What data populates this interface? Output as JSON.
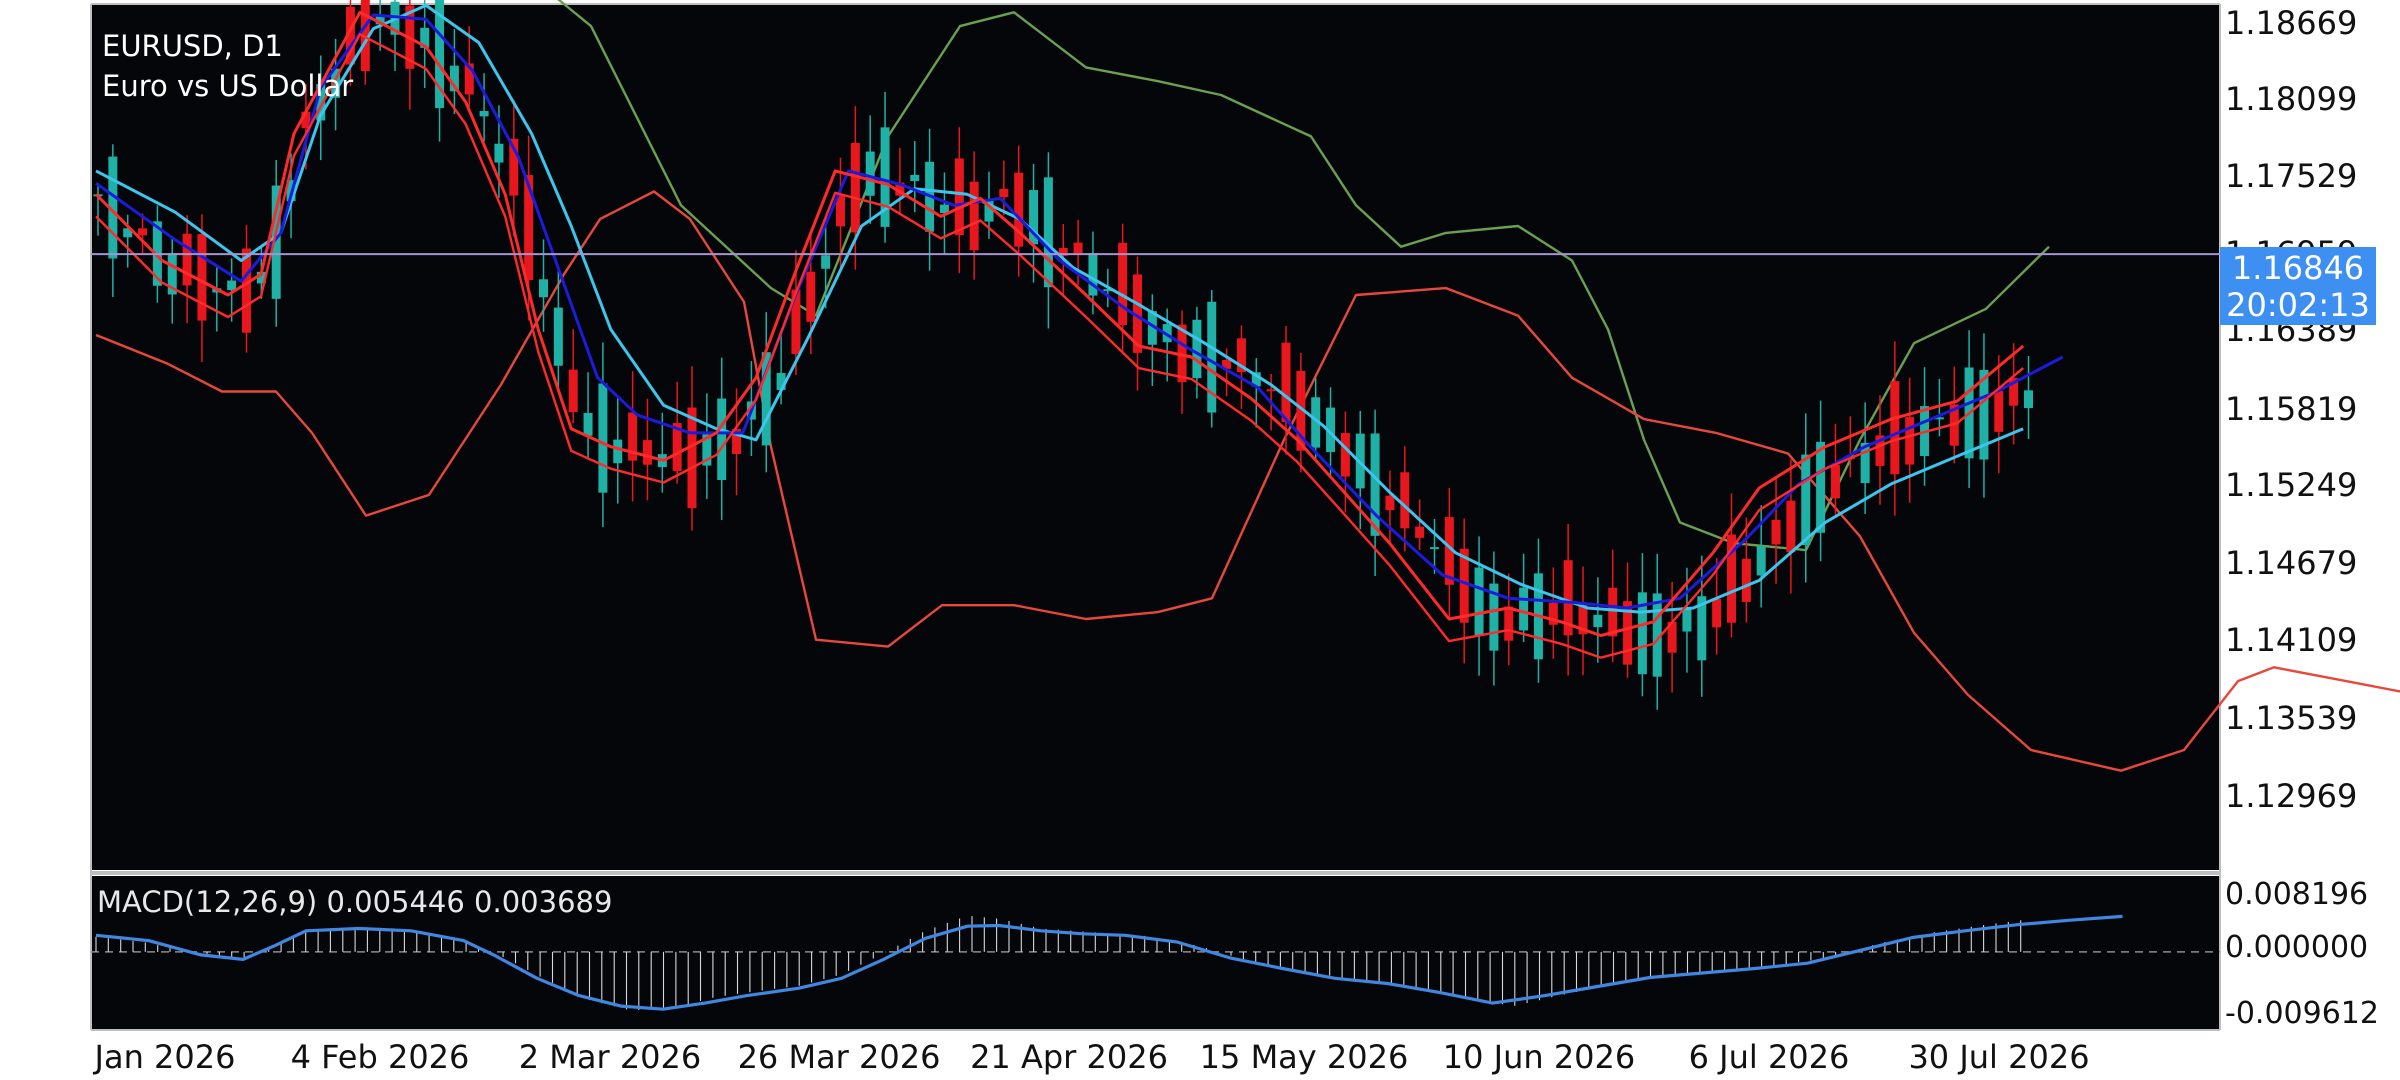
{
  "header": {
    "symbol_line": "EURUSD, D1",
    "description": "Euro vs US Dollar"
  },
  "price_box": {
    "price": "1.16846",
    "countdown": "20:02:13"
  },
  "macd_label": "MACD(12,26,9) 0.005446 0.003689",
  "more_label": "•••",
  "colors": {
    "background": "#ffffff",
    "plot_bg": "#050609",
    "bull": "#1fb0a6",
    "bear": "#e8171d",
    "ma_fast": "#ff2a2a",
    "ma_mid": "#1c1cdc",
    "ma_slow": "#3cc6ee",
    "band_upper": "#6aa052",
    "band_lower": "#e8483c",
    "price_line": "#a594d0",
    "macd_line": "#3f87e0",
    "hist": "#d8d8d8",
    "price_tag": "#3e8ff2"
  },
  "chart_data": [
    {
      "type": "candlestick",
      "title": "EURUSD, D1",
      "subtitle": "Euro vs US Dollar",
      "y_ticks": [
        "1.18669",
        "1.18099",
        "1.17529",
        "1.16959",
        "1.16389",
        "1.15819",
        "1.15249",
        "1.14679",
        "1.14109",
        "1.13539",
        "1.12969"
      ],
      "ylim": [
        1.1238,
        1.1866
      ],
      "x_ticks": [
        "Jan 2026",
        "4 Feb 2026",
        "2 Mar 2026",
        "26 Mar 2026",
        "21 Apr 2026",
        "15 May 2026",
        "10 Jun 2026",
        "6 Jul 2026",
        "30 Jul 2026"
      ],
      "x_tick_index": [
        0,
        26,
        50,
        74,
        100,
        124,
        150,
        174,
        198
      ],
      "current_price": 1.16846,
      "bands": {
        "upper": [
          [
            0,
            1.193
          ],
          [
            20,
            1.19
          ],
          [
            40,
            1.193
          ],
          [
            55,
            1.185
          ],
          [
            65,
            1.172
          ],
          [
            75,
            1.166
          ],
          [
            80,
            1.164
          ],
          [
            88,
            1.177
          ],
          [
            96,
            1.185
          ],
          [
            102,
            1.186
          ],
          [
            110,
            1.182
          ],
          [
            118,
            1.181
          ],
          [
            125,
            1.18
          ],
          [
            135,
            1.177
          ],
          [
            140,
            1.172
          ],
          [
            145,
            1.169
          ],
          [
            150,
            1.17
          ],
          [
            158,
            1.1705
          ],
          [
            164,
            1.168
          ],
          [
            168,
            1.163
          ],
          [
            172,
            1.155
          ],
          [
            176,
            1.149
          ],
          [
            182,
            1.1475
          ],
          [
            190,
            1.147
          ],
          [
            196,
            1.155
          ],
          [
            202,
            1.162
          ],
          [
            210,
            1.1645
          ],
          [
            217,
            1.169
          ]
        ],
        "lower": [
          [
            0,
            1.1626
          ],
          [
            8,
            1.1605
          ],
          [
            14,
            1.1585
          ],
          [
            20,
            1.1585
          ],
          [
            24,
            1.1555
          ],
          [
            30,
            1.1495
          ],
          [
            37,
            1.151
          ],
          [
            45,
            1.159
          ],
          [
            52,
            1.167
          ],
          [
            56,
            1.171
          ],
          [
            62,
            1.173
          ],
          [
            66,
            1.171
          ],
          [
            72,
            1.165
          ],
          [
            75,
            1.1545
          ],
          [
            80,
            1.1405
          ],
          [
            88,
            1.14
          ],
          [
            94,
            1.143
          ],
          [
            102,
            1.143
          ],
          [
            110,
            1.142
          ],
          [
            118,
            1.1425
          ],
          [
            124,
            1.1435
          ],
          [
            132,
            1.155
          ],
          [
            140,
            1.1655
          ],
          [
            150,
            1.166
          ],
          [
            158,
            1.164
          ],
          [
            164,
            1.1595
          ],
          [
            172,
            1.1565
          ],
          [
            180,
            1.1555
          ],
          [
            188,
            1.154
          ],
          [
            196,
            1.148
          ],
          [
            202,
            1.141
          ],
          [
            208,
            1.1365
          ],
          [
            215,
            1.1325
          ],
          [
            225,
            1.131
          ],
          [
            232,
            1.1325
          ],
          [
            238,
            1.1375
          ],
          [
            242,
            1.1385
          ],
          [
            250,
            1.1375
          ],
          [
            258,
            1.1365
          ],
          [
            265,
            1.1355
          ],
          [
            272,
            1.134
          ],
          [
            280,
            1.1345
          ],
          [
            288,
            1.1355
          ],
          [
            295,
            1.1375
          ],
          [
            302,
            1.1425
          ]
        ]
      },
      "moving_averages": {
        "fast": [
          [
            0,
            1.1728
          ],
          [
            10,
            1.168
          ],
          [
            20,
            1.1655
          ],
          [
            25,
            1.167
          ],
          [
            30,
            1.1772
          ],
          [
            40,
            1.186
          ],
          [
            50,
            1.1835
          ],
          [
            56,
            1.1795
          ],
          [
            62,
            1.1728
          ],
          [
            67,
            1.163
          ],
          [
            72,
            1.1558
          ],
          [
            78,
            1.1545
          ],
          [
            86,
            1.1535
          ],
          [
            94,
            1.1555
          ],
          [
            100,
            1.1595
          ],
          [
            106,
            1.1672
          ],
          [
            112,
            1.1745
          ],
          [
            120,
            1.1735
          ],
          [
            128,
            1.1712
          ],
          [
            134,
            1.1725
          ],
          [
            140,
            1.17
          ],
          [
            150,
            1.1655
          ],
          [
            158,
            1.1618
          ],
          [
            166,
            1.161
          ],
          [
            175,
            1.158
          ],
          [
            182,
            1.155
          ],
          [
            188,
            1.1518
          ],
          [
            196,
            1.1475
          ],
          [
            205,
            1.142
          ],
          [
            214,
            1.1428
          ],
          [
            222,
            1.1418
          ],
          [
            228,
            1.1408
          ],
          [
            236,
            1.1418
          ],
          [
            245,
            1.1468
          ],
          [
            252,
            1.1515
          ],
          [
            262,
            1.1545
          ],
          [
            272,
            1.1565
          ],
          [
            282,
            1.1578
          ],
          [
            292,
            1.1618
          ]
        ],
        "mid": [
          [
            0,
            1.1736
          ],
          [
            12,
            1.1695
          ],
          [
            22,
            1.1665
          ],
          [
            28,
            1.17
          ],
          [
            34,
            1.1805
          ],
          [
            42,
            1.1858
          ],
          [
            50,
            1.1855
          ],
          [
            57,
            1.1818
          ],
          [
            64,
            1.1755
          ],
          [
            70,
            1.1675
          ],
          [
            76,
            1.1595
          ],
          [
            82,
            1.1568
          ],
          [
            90,
            1.1555
          ],
          [
            98,
            1.1555
          ],
          [
            106,
            1.1655
          ],
          [
            114,
            1.1745
          ],
          [
            122,
            1.1735
          ],
          [
            130,
            1.172
          ],
          [
            137,
            1.1725
          ],
          [
            146,
            1.168
          ],
          [
            156,
            1.1645
          ],
          [
            166,
            1.1615
          ],
          [
            176,
            1.1588
          ],
          [
            184,
            1.1545
          ],
          [
            194,
            1.1495
          ],
          [
            204,
            1.1452
          ],
          [
            214,
            1.1435
          ],
          [
            224,
            1.1432
          ],
          [
            232,
            1.1428
          ],
          [
            240,
            1.1435
          ],
          [
            250,
            1.1478
          ],
          [
            258,
            1.1518
          ],
          [
            268,
            1.1545
          ],
          [
            278,
            1.1565
          ],
          [
            288,
            1.1585
          ],
          [
            298,
            1.161
          ]
        ],
        "slow": [
          [
            0,
            1.1745
          ],
          [
            12,
            1.1715
          ],
          [
            22,
            1.168
          ],
          [
            28,
            1.17
          ],
          [
            34,
            1.1785
          ],
          [
            42,
            1.1848
          ],
          [
            50,
            1.1865
          ],
          [
            58,
            1.1838
          ],
          [
            66,
            1.1772
          ],
          [
            72,
            1.1705
          ],
          [
            78,
            1.163
          ],
          [
            86,
            1.1575
          ],
          [
            94,
            1.1558
          ],
          [
            100,
            1.155
          ],
          [
            108,
            1.1625
          ],
          [
            116,
            1.1705
          ],
          [
            124,
            1.1732
          ],
          [
            132,
            1.1728
          ],
          [
            140,
            1.171
          ],
          [
            148,
            1.1675
          ],
          [
            158,
            1.1648
          ],
          [
            168,
            1.162
          ],
          [
            178,
            1.159
          ],
          [
            186,
            1.156
          ],
          [
            196,
            1.1512
          ],
          [
            206,
            1.1468
          ],
          [
            216,
            1.1445
          ],
          [
            226,
            1.1428
          ],
          [
            234,
            1.1425
          ],
          [
            242,
            1.1428
          ],
          [
            252,
            1.1448
          ],
          [
            262,
            1.149
          ],
          [
            272,
            1.1518
          ],
          [
            282,
            1.1538
          ],
          [
            292,
            1.1558
          ]
        ]
      }
    },
    {
      "type": "macd",
      "title": "MACD(12,26,9) 0.005446 0.003689",
      "y_ticks": [
        "0.008196",
        "0.000000",
        "-0.009612"
      ],
      "ylim": [
        -0.0101,
        0.0098
      ],
      "macd": 0.005446,
      "signal": 0.003689,
      "signal_line": [
        [
          0,
          0.0022
        ],
        [
          10,
          0.0015
        ],
        [
          20,
          -0.0004
        ],
        [
          28,
          -0.001
        ],
        [
          34,
          0.0008
        ],
        [
          40,
          0.0028
        ],
        [
          50,
          0.0031
        ],
        [
          60,
          0.0028
        ],
        [
          70,
          0.0015
        ],
        [
          76,
          -0.0005
        ],
        [
          84,
          -0.0035
        ],
        [
          92,
          -0.0058
        ],
        [
          100,
          -0.0072
        ],
        [
          108,
          -0.0076
        ],
        [
          116,
          -0.0068
        ],
        [
          124,
          -0.0058
        ],
        [
          134,
          -0.0048
        ],
        [
          142,
          -0.0035
        ],
        [
          150,
          -0.001
        ],
        [
          158,
          0.0018
        ],
        [
          166,
          0.0034
        ],
        [
          172,
          0.0035
        ],
        [
          180,
          0.0028
        ],
        [
          188,
          0.0024
        ],
        [
          196,
          0.0022
        ],
        [
          206,
          0.0013
        ],
        [
          216,
          -0.0008
        ],
        [
          226,
          -0.0022
        ],
        [
          236,
          -0.0035
        ],
        [
          246,
          -0.0042
        ],
        [
          256,
          -0.0054
        ],
        [
          266,
          -0.0068
        ],
        [
          276,
          -0.0058
        ],
        [
          286,
          -0.0046
        ],
        [
          296,
          -0.0034
        ],
        [
          306,
          -0.0028
        ],
        [
          316,
          -0.0022
        ],
        [
          326,
          -0.0015
        ],
        [
          336,
          0.0002
        ],
        [
          346,
          0.0019
        ],
        [
          356,
          0.0028
        ],
        [
          366,
          0.0036
        ],
        [
          376,
          0.0042
        ],
        [
          386,
          0.0047
        ]
      ],
      "histogram": [
        [
          0,
          0.002
        ],
        [
          10,
          0.0012
        ],
        [
          20,
          -0.0005
        ],
        [
          28,
          -0.0008
        ],
        [
          34,
          0.0009
        ],
        [
          40,
          0.0029
        ],
        [
          50,
          0.0033
        ],
        [
          60,
          0.003
        ],
        [
          70,
          0.0014
        ],
        [
          78,
          -0.0008
        ],
        [
          86,
          -0.0038
        ],
        [
          94,
          -0.0064
        ],
        [
          102,
          -0.0078
        ],
        [
          110,
          -0.0074
        ],
        [
          118,
          -0.006
        ],
        [
          126,
          -0.0052
        ],
        [
          134,
          -0.0045
        ],
        [
          142,
          -0.003
        ],
        [
          150,
          -0.0002
        ],
        [
          158,
          0.0028
        ],
        [
          166,
          0.0048
        ],
        [
          172,
          0.0044
        ],
        [
          180,
          0.0031
        ],
        [
          190,
          0.0026
        ],
        [
          200,
          0.0021
        ],
        [
          210,
          0.0008
        ],
        [
          220,
          -0.0013
        ],
        [
          230,
          -0.0026
        ],
        [
          240,
          -0.0037
        ],
        [
          250,
          -0.0046
        ],
        [
          260,
          -0.006
        ],
        [
          270,
          -0.0072
        ],
        [
          280,
          -0.0056
        ],
        [
          290,
          -0.0042
        ],
        [
          300,
          -0.0031
        ],
        [
          310,
          -0.0026
        ],
        [
          320,
          -0.0018
        ],
        [
          330,
          -0.0008
        ],
        [
          340,
          0.0012
        ],
        [
          350,
          0.0026
        ],
        [
          360,
          0.0036
        ],
        [
          370,
          0.0045
        ],
        [
          380,
          0.0055
        ],
        [
          386,
          0.0058
        ]
      ]
    }
  ]
}
